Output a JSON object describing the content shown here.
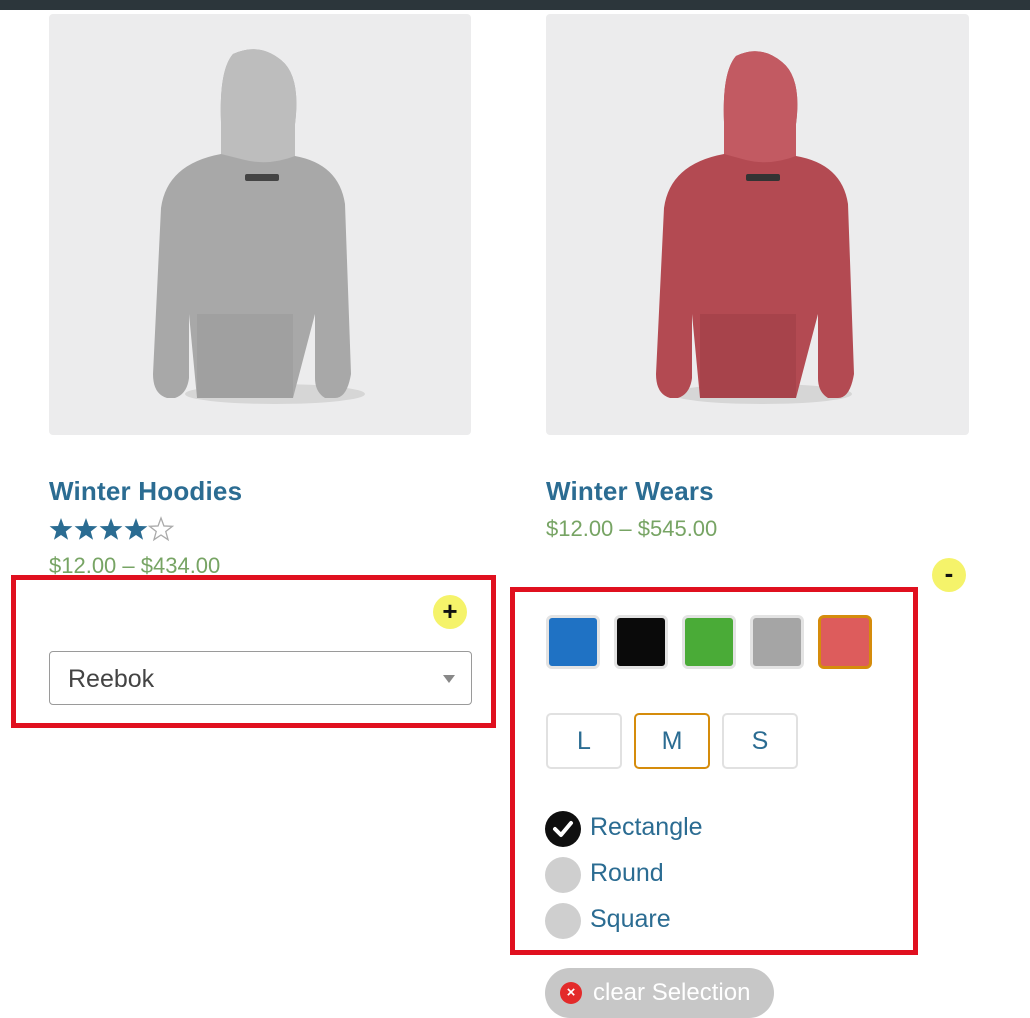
{
  "colors": {
    "title_blue": "#2b6c92",
    "price_green": "#77a464",
    "highlight_red": "#e0101f",
    "toggle_yellow": "#f5f36a",
    "selected_orange": "#d58c0c"
  },
  "products": [
    {
      "title": "Winter Hoodies",
      "rating": 4,
      "rating_max": 5,
      "price": "$12.00 – $434.00",
      "toggle_label": "+",
      "brand_select": {
        "value": "Reebok"
      },
      "image": "grey-hoodie-back-image"
    },
    {
      "title": "Winter Wears",
      "price": "$12.00 – $545.00",
      "toggle_label": "-",
      "image": "red-hoodie-back-image",
      "color_swatches": [
        {
          "name": "blue",
          "hex": "#1f72c4",
          "selected": false
        },
        {
          "name": "black",
          "hex": "#0a0a0a",
          "selected": false
        },
        {
          "name": "green",
          "hex": "#4aab37",
          "selected": false
        },
        {
          "name": "grey",
          "hex": "#a5a5a5",
          "selected": false
        },
        {
          "name": "red",
          "hex": "#dd5c5c",
          "selected": true
        }
      ],
      "sizes": [
        {
          "label": "L",
          "selected": false
        },
        {
          "label": "M",
          "selected": true
        },
        {
          "label": "S",
          "selected": false
        }
      ],
      "shapes": [
        {
          "label": "Rectangle",
          "checked": true
        },
        {
          "label": "Round",
          "checked": false
        },
        {
          "label": "Square",
          "checked": false
        }
      ],
      "clear_label": "clear Selection",
      "clear_icon": "×"
    }
  ]
}
